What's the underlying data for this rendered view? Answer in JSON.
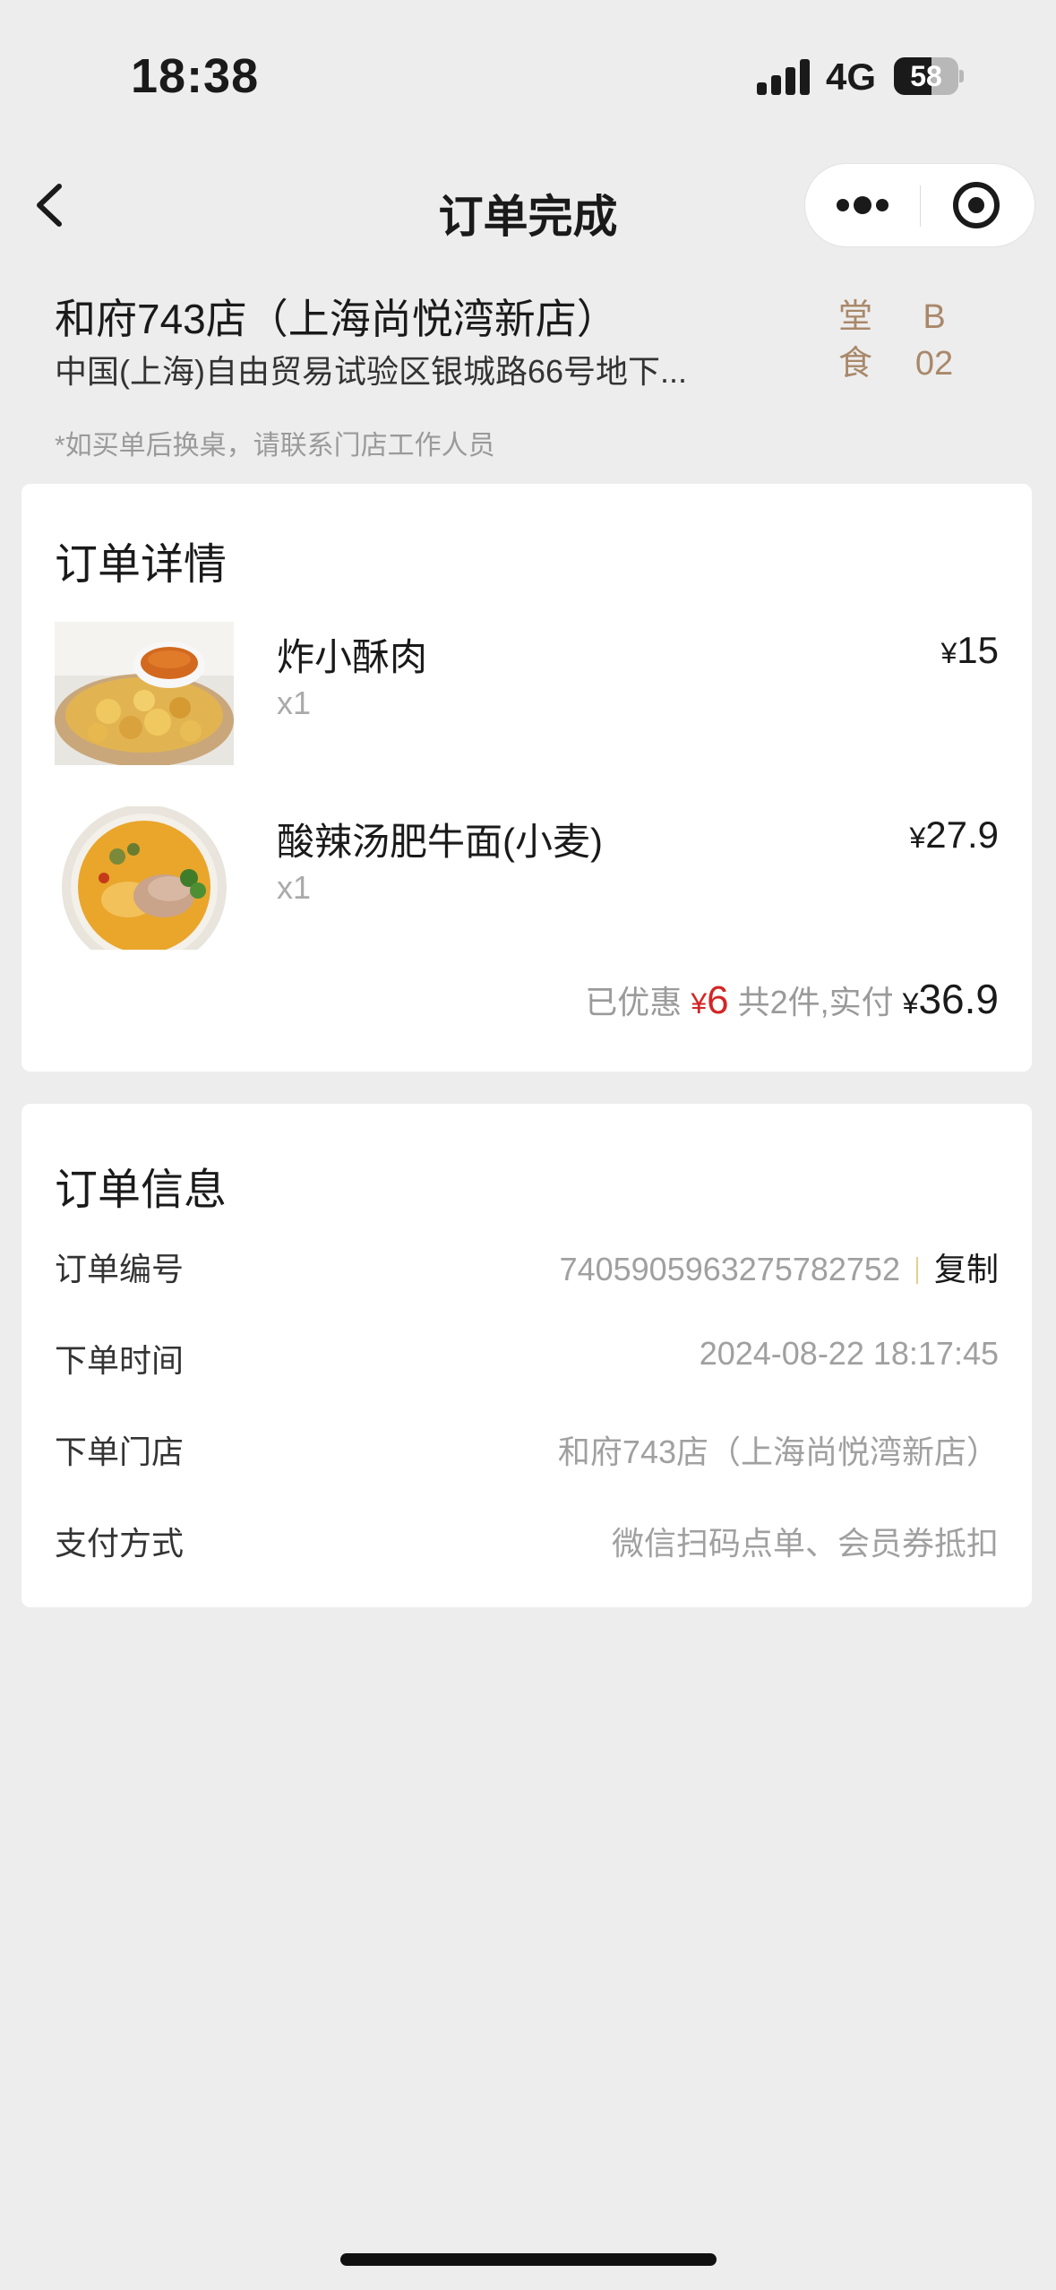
{
  "status_bar": {
    "time": "18:38",
    "network": "4G",
    "battery_level": "58",
    "battery_fraction": 0.58
  },
  "nav": {
    "title": "订单完成",
    "back_icon": "chevron-left-icon",
    "more_icon": "more-dots-icon",
    "close_icon": "target-close-icon"
  },
  "store": {
    "name": "和府743店（上海尚悦湾新店）",
    "address": "中国(上海)自由贸易试验区银城路66号地下...",
    "dine_type": [
      "堂",
      "食"
    ],
    "table_number": [
      "B",
      "02"
    ],
    "note": "*如买单后换桌，请联系门店工作人员"
  },
  "order_detail": {
    "title": "订单详情",
    "items": [
      {
        "name": "炸小酥肉",
        "qty": "x1",
        "currency": "¥",
        "price": "15"
      },
      {
        "name": "酸辣汤肥牛面(小麦)",
        "qty": "x1",
        "currency": "¥",
        "price": "27.9"
      }
    ],
    "summary": {
      "discount_label": "已优惠",
      "currency": "¥",
      "discount_value": "6",
      "count_label": "共2件,实付",
      "total_value": "36.9"
    }
  },
  "order_info": {
    "title": "订单信息",
    "rows": [
      {
        "label": "订单编号",
        "value": "7405905963275782752",
        "action": "复制"
      },
      {
        "label": "下单时间",
        "value": "2024-08-22 18:17:45"
      },
      {
        "label": "下单门店",
        "value": "和府743店（上海尚悦湾新店）"
      },
      {
        "label": "支付方式",
        "value": "微信扫码点单、会员券抵扣"
      }
    ]
  },
  "colors": {
    "background": "#ededed",
    "card": "#ffffff",
    "accent_gold": "#a9886a",
    "discount_red": "#d42525"
  }
}
